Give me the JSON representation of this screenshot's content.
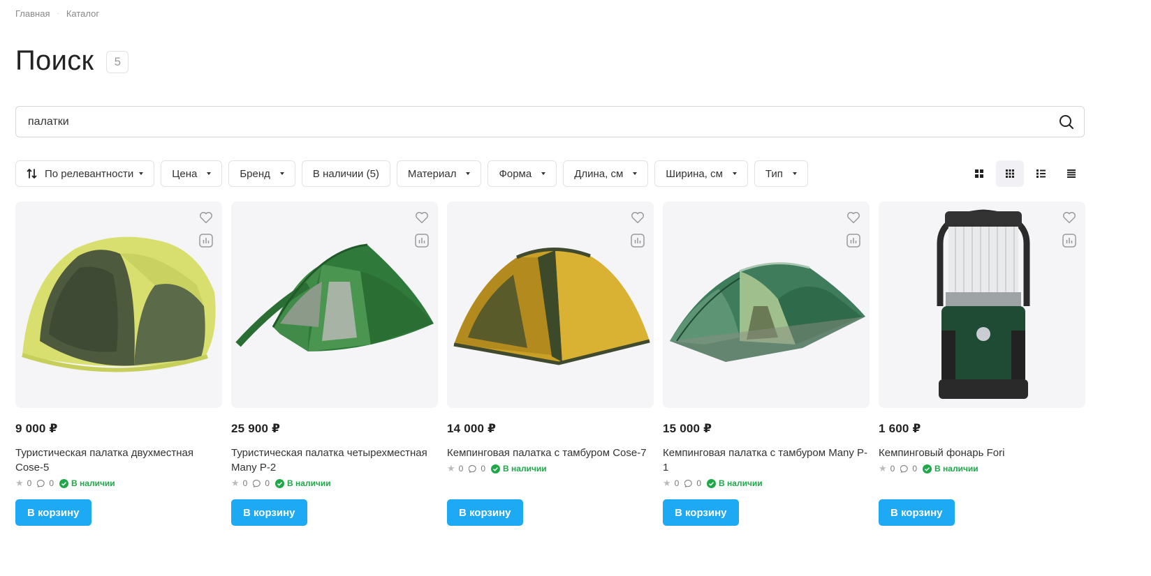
{
  "breadcrumbs": {
    "home": "Главная",
    "separator": "·",
    "catalog": "Каталог"
  },
  "page": {
    "title": "Поиск",
    "count": "5"
  },
  "search": {
    "value": "палатки",
    "placeholder": "",
    "icon": "search-icon"
  },
  "filters": {
    "sort": "По релевантности",
    "price": "Цена",
    "brand": "Бренд",
    "in_stock": "В наличии (5)",
    "material": "Материал",
    "shape": "Форма",
    "length": "Длина, см",
    "width": "Ширина, см",
    "type": "Тип"
  },
  "view_modes": [
    "grid-large-icon",
    "grid-small-icon",
    "list-icon",
    "compact-list-icon"
  ],
  "active_view": "grid-small",
  "accent_color": "#1da9f3",
  "stock_color": "#1fa84a",
  "products": [
    {
      "price": "9 000 ₽",
      "name": "Туристическая палатка двухместная Cose-5",
      "rating": "0",
      "reviews": "0",
      "stock": "В наличии",
      "button": "В корзину"
    },
    {
      "price": "25 900 ₽",
      "name": "Туристическая палатка четырехместная Many P-2",
      "rating": "0",
      "reviews": "0",
      "stock": "В наличии",
      "button": "В корзину"
    },
    {
      "price": "14 000 ₽",
      "name": "Кемпинговая палатка с тамбуром Cose-7",
      "rating": "0",
      "reviews": "0",
      "stock": "В наличии",
      "button": "В корзину"
    },
    {
      "price": "15 000 ₽",
      "name": "Кемпинговая палатка с тамбуром Many P-1",
      "rating": "0",
      "reviews": "0",
      "stock": "В наличии",
      "button": "В корзину"
    },
    {
      "price": "1 600 ₽",
      "name": "Кемпинговый фонарь Fori",
      "rating": "0",
      "reviews": "0",
      "stock": "В наличии",
      "button": "В корзину"
    }
  ]
}
